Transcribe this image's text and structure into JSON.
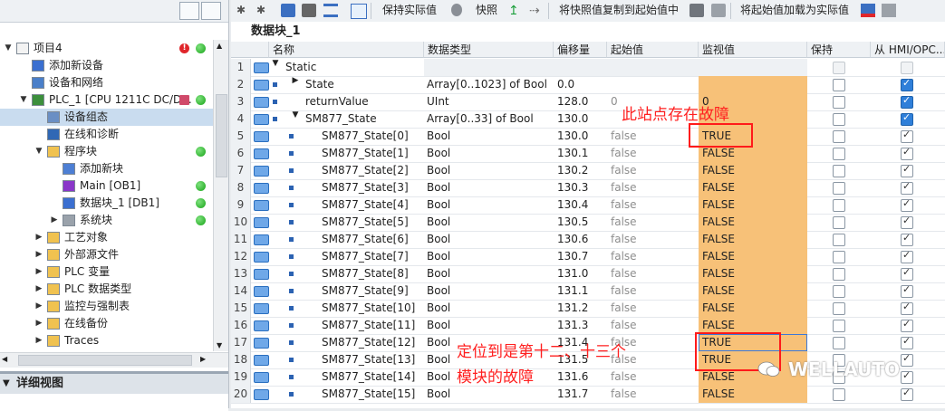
{
  "project_tree": {
    "items": [
      {
        "label": "项目4",
        "level": 0,
        "expanded": true,
        "icon": "project-icon",
        "status": "error-and-ok"
      },
      {
        "label": "添加新设备",
        "level": 1,
        "icon": "add-device-icon"
      },
      {
        "label": "设备和网络",
        "level": 1,
        "icon": "network-icon"
      },
      {
        "label": "PLC_1 [CPU 1211C DC/D...",
        "level": 1,
        "expanded": true,
        "icon": "plc-icon",
        "status": "warning-and-ok"
      },
      {
        "label": "设备组态",
        "level": 2,
        "icon": "device-config-icon",
        "selected": true
      },
      {
        "label": "在线和诊断",
        "level": 2,
        "icon": "online-diag-icon"
      },
      {
        "label": "程序块",
        "level": 2,
        "expanded": true,
        "icon": "folder-icon",
        "status": "ok"
      },
      {
        "label": "添加新块",
        "level": 3,
        "icon": "add-block-icon"
      },
      {
        "label": "Main [OB1]",
        "level": 3,
        "icon": "ob-icon",
        "status": "ok"
      },
      {
        "label": "数据块_1 [DB1]",
        "level": 3,
        "icon": "db-icon",
        "status": "ok"
      },
      {
        "label": "系统块",
        "level": 3,
        "collapsed": true,
        "icon": "system-block-icon",
        "status": "ok"
      },
      {
        "label": "工艺对象",
        "level": 2,
        "collapsed": true,
        "icon": "folder-icon"
      },
      {
        "label": "外部源文件",
        "level": 2,
        "collapsed": true,
        "icon": "folder-icon"
      },
      {
        "label": "PLC 变量",
        "level": 2,
        "collapsed": true,
        "icon": "folder-icon"
      },
      {
        "label": "PLC 数据类型",
        "level": 2,
        "collapsed": true,
        "icon": "folder-icon"
      },
      {
        "label": "监控与强制表",
        "level": 2,
        "collapsed": true,
        "icon": "folder-icon"
      },
      {
        "label": "在线备份",
        "level": 2,
        "collapsed": true,
        "icon": "folder-icon"
      },
      {
        "label": "Traces",
        "level": 2,
        "collapsed": true,
        "icon": "folder-icon"
      }
    ],
    "error_badge": "!"
  },
  "detail_view": {
    "label": "详细视图"
  },
  "toolbar": {
    "keep_actual": "保持实际值",
    "snapshot": "快照",
    "copy_snapshot": "将快照值复制到起始值中",
    "load_start": "将起始值加载为实际值"
  },
  "block_title": "数据块_1",
  "columns": [
    "名称",
    "数据类型",
    "偏移量",
    "起始值",
    "监视值",
    "保持",
    "从 HMI/OPC..."
  ],
  "rows": [
    {
      "n": "1",
      "name": "Static",
      "type": "",
      "offset": "",
      "start": "",
      "monitor": "",
      "level": 0,
      "expander": "down",
      "static": true
    },
    {
      "n": "2",
      "name": "State",
      "type": "Array[0..1023] of Bool",
      "offset": "0.0",
      "start": "",
      "monitor": "",
      "level": 1,
      "expander": "right"
    },
    {
      "n": "3",
      "name": "returnValue",
      "type": "UInt",
      "offset": "128.0",
      "start": "0",
      "monitor": "0",
      "level": 1
    },
    {
      "n": "4",
      "name": "SM877_State",
      "type": "Array[0..33] of Bool",
      "offset": "130.0",
      "start": "",
      "monitor": "",
      "level": 1,
      "expander": "down"
    },
    {
      "n": "5",
      "name": "SM877_State[0]",
      "type": "Bool",
      "offset": "130.0",
      "start": "false",
      "monitor": "TRUE",
      "level": 2
    },
    {
      "n": "6",
      "name": "SM877_State[1]",
      "type": "Bool",
      "offset": "130.1",
      "start": "false",
      "monitor": "FALSE",
      "level": 2
    },
    {
      "n": "7",
      "name": "SM877_State[2]",
      "type": "Bool",
      "offset": "130.2",
      "start": "false",
      "monitor": "FALSE",
      "level": 2
    },
    {
      "n": "8",
      "name": "SM877_State[3]",
      "type": "Bool",
      "offset": "130.3",
      "start": "false",
      "monitor": "FALSE",
      "level": 2
    },
    {
      "n": "9",
      "name": "SM877_State[4]",
      "type": "Bool",
      "offset": "130.4",
      "start": "false",
      "monitor": "FALSE",
      "level": 2
    },
    {
      "n": "10",
      "name": "SM877_State[5]",
      "type": "Bool",
      "offset": "130.5",
      "start": "false",
      "monitor": "FALSE",
      "level": 2
    },
    {
      "n": "11",
      "name": "SM877_State[6]",
      "type": "Bool",
      "offset": "130.6",
      "start": "false",
      "monitor": "FALSE",
      "level": 2
    },
    {
      "n": "12",
      "name": "SM877_State[7]",
      "type": "Bool",
      "offset": "130.7",
      "start": "false",
      "monitor": "FALSE",
      "level": 2
    },
    {
      "n": "13",
      "name": "SM877_State[8]",
      "type": "Bool",
      "offset": "131.0",
      "start": "false",
      "monitor": "FALSE",
      "level": 2
    },
    {
      "n": "14",
      "name": "SM877_State[9]",
      "type": "Bool",
      "offset": "131.1",
      "start": "false",
      "monitor": "FALSE",
      "level": 2
    },
    {
      "n": "15",
      "name": "SM877_State[10]",
      "type": "Bool",
      "offset": "131.2",
      "start": "false",
      "monitor": "FALSE",
      "level": 2
    },
    {
      "n": "16",
      "name": "SM877_State[11]",
      "type": "Bool",
      "offset": "131.3",
      "start": "false",
      "monitor": "FALSE",
      "level": 2
    },
    {
      "n": "17",
      "name": "SM877_State[12]",
      "type": "Bool",
      "offset": "131.4",
      "start": "false",
      "monitor": "TRUE",
      "level": 2
    },
    {
      "n": "18",
      "name": "SM877_State[13]",
      "type": "Bool",
      "offset": "131.5",
      "start": "false",
      "monitor": "TRUE",
      "level": 2
    },
    {
      "n": "19",
      "name": "SM877_State[14]",
      "type": "Bool",
      "offset": "131.6",
      "start": "false",
      "monitor": "FALSE",
      "level": 2
    },
    {
      "n": "20",
      "name": "SM877_State[15]",
      "type": "Bool",
      "offset": "131.7",
      "start": "false",
      "monitor": "FALSE",
      "level": 2
    }
  ],
  "annotations": {
    "fault": "此站点存在故障",
    "locate_line1": "定位到是第十二、十三个",
    "locate_line2": "模块的故障"
  },
  "watermark": "WELLAUTO",
  "colors": {
    "monitor_bg": "#f7c178",
    "annotation": "#ff2020",
    "selected": "#c9dcef"
  }
}
